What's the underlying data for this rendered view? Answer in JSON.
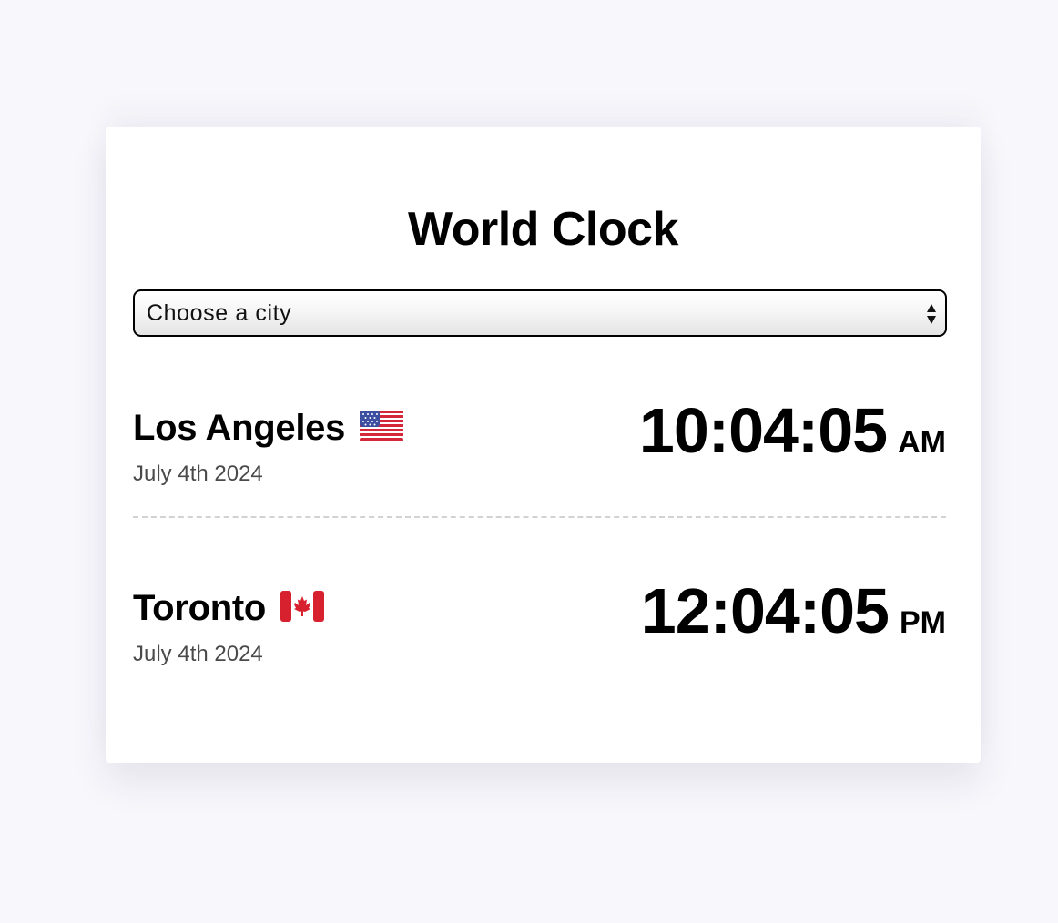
{
  "title": "World Clock",
  "city_select": {
    "selected_label": "Choose a city"
  },
  "cities": [
    {
      "name": "Los Angeles",
      "flag_icon": "us-flag-icon",
      "date": "July 4th 2024",
      "time": "10:04:05",
      "ampm": "AM"
    },
    {
      "name": "Toronto",
      "flag_icon": "canada-flag-icon",
      "date": "July 4th 2024",
      "time": "12:04:05",
      "ampm": "PM"
    }
  ],
  "colors": {
    "page_background": "#f8f7fc",
    "card_background": "#ffffff",
    "date_text": "#4a4a4a",
    "divider": "#d2d2d2"
  }
}
